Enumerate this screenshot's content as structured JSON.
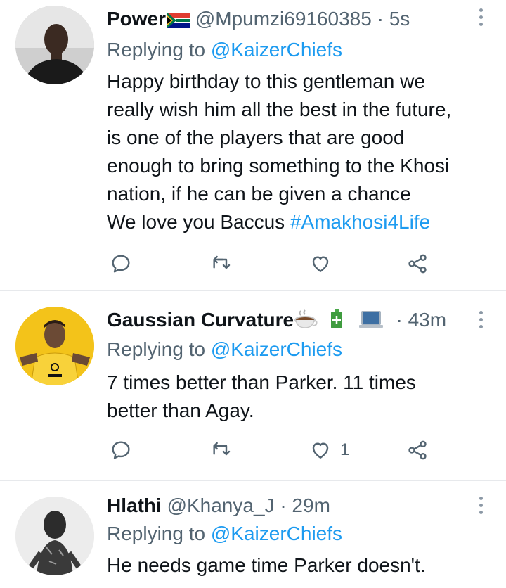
{
  "tweets": [
    {
      "name": "Power",
      "handle": "@Mpumzi69160385",
      "separator": "·",
      "time": "5s",
      "replying_prefix": "Replying to",
      "replying_to": "@KaizerChiefs",
      "body_lines": [
        "Happy birthday to this gentleman we",
        "really wish him all the best in the future,",
        "is one of the players that are good",
        "enough to bring something to the Khosi",
        "nation, if he can be given a chance",
        "We love you Baccus"
      ],
      "hashtag": "#Amakhosi4Life",
      "like_count": ""
    },
    {
      "name": "Gaussian Curvature",
      "handle": "",
      "separator": "·",
      "time": "43m",
      "replying_prefix": "Replying to",
      "replying_to": "@KaizerChiefs",
      "body_lines": [
        "7 times better than Parker. 11 times",
        "better than Agay."
      ],
      "like_count": "1"
    },
    {
      "name": "Hlathi",
      "handle": "@Khanya_J",
      "separator": "·",
      "time": "29m",
      "replying_prefix": "Replying to",
      "replying_to": "@KaizerChiefs",
      "body_lines": [
        "He needs game time Parker doesn't."
      ]
    }
  ],
  "icons": {
    "reply": "speech-bubble",
    "retweet": "retweet-arrows",
    "like": "heart",
    "share": "share-nodes",
    "more": "vertical-ellipsis"
  },
  "colors": {
    "link": "#1d9bf0",
    "secondary_text": "#536471",
    "divider": "#e7e9ec"
  }
}
